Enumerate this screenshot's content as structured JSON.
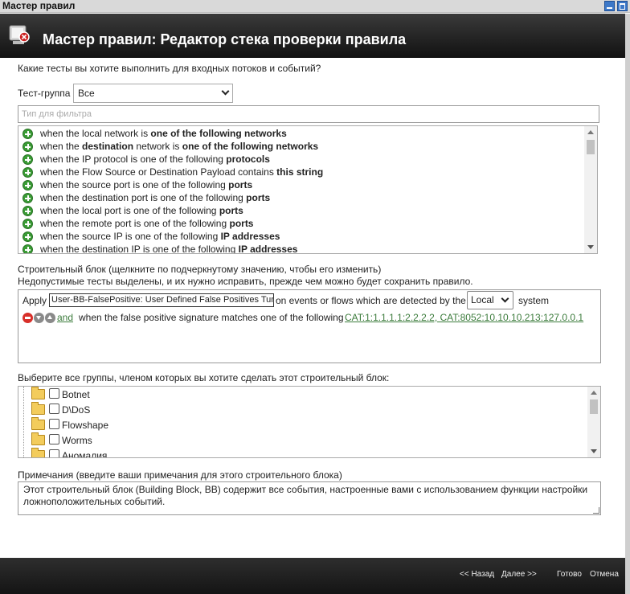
{
  "window": {
    "title": "Мастер правил"
  },
  "header": {
    "title": "Мастер правил: Редактор стека проверки правила"
  },
  "question": "Какие тесты вы хотите выполнить для входных потоков и событий?",
  "test_group": {
    "label": "Тест-группа",
    "value": "Все"
  },
  "filter": {
    "placeholder": "Тип для фильтра"
  },
  "tests": [
    {
      "pre": "when the local network is ",
      "bold": "one of the following networks",
      "post": ""
    },
    {
      "pre": "when the ",
      "bold": "destination",
      "post": " network is ",
      "bold2": "one of the following networks"
    },
    {
      "pre": "when the IP protocol is one of the following ",
      "bold": "protocols",
      "post": ""
    },
    {
      "pre": "when the Flow Source or Destination Payload contains ",
      "bold": "this string",
      "post": ""
    },
    {
      "pre": "when the source port is one of the following ",
      "bold": "ports",
      "post": ""
    },
    {
      "pre": "when the destination port is one of the following ",
      "bold": "ports",
      "post": ""
    },
    {
      "pre": "when the local port is one of the following ",
      "bold": "ports",
      "post": ""
    },
    {
      "pre": "when the remote port is one of the following ",
      "bold": "ports",
      "post": ""
    },
    {
      "pre": "when the source IP is one of the following ",
      "bold": "IP addresses",
      "post": ""
    },
    {
      "pre": "when the destination IP is one of the following ",
      "bold": "IP addresses",
      "post": ""
    }
  ],
  "building_block": {
    "hint1": "Строительный блок (щелкните по подчеркнутому значению, чтобы его изменить)",
    "hint2": "Недопустимые тесты выделены, и их нужно исправить, прежде чем можно будет сохранить правило.",
    "apply": "Apply",
    "name": "User-BB-FalsePositive: User Defined False Positives Tuni",
    "on_events": "on events or flows which are detected by the",
    "scope": "Local",
    "system": "system",
    "and": " and ",
    "condition": "when the false positive signature matches one of the following",
    "value_link": "CAT:1:1.1.1.1:2.2.2.2, CAT:8052:10.10.10.213:127.0.0.1"
  },
  "groups": {
    "label": "Выберите все группы, членом которых вы хотите сделать этот строительный блок:",
    "items": [
      "Botnet",
      "D\\DoS",
      "Flowshape",
      "Worms",
      "Аномалия"
    ]
  },
  "notes": {
    "label": "Примечания (введите ваши примечания для этого строительного блока)",
    "value": "Этот строительный блок (Building Block, BB) содержит все события, настроенные вами с использованием функции настройки ложноположительных событий."
  },
  "footer": {
    "back": "<< Назад",
    "next": "Далее >>",
    "finish": "Готово",
    "cancel": "Отмена"
  },
  "colors": {
    "header_bg": "#1a1a1a",
    "add_icon": "#3a9c35",
    "remove_icon": "#d8302a",
    "link": "#3b7b3b"
  }
}
